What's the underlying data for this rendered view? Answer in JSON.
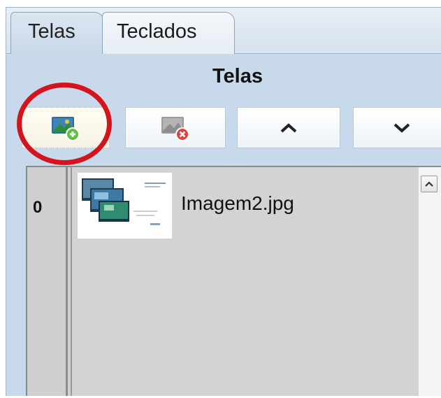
{
  "tabs": [
    {
      "label": "Telas",
      "active": true
    },
    {
      "label": "Teclados",
      "active": false
    }
  ],
  "panel": {
    "title": "Telas"
  },
  "toolbar": {
    "buttons": [
      {
        "name": "add-screen-button",
        "icon": "add-image-icon",
        "state": "focused"
      },
      {
        "name": "remove-screen-button",
        "icon": "remove-image-icon",
        "state": "disabled"
      },
      {
        "name": "move-up-button",
        "icon": "chevron-up-icon"
      },
      {
        "name": "move-down-button",
        "icon": "chevron-down-icon"
      }
    ]
  },
  "annotation": {
    "type": "highlight-circle",
    "color": "#d4141c",
    "target": "add-screen-button"
  },
  "list": {
    "items": [
      {
        "index": "0",
        "filename": "Imagem2.jpg",
        "thumbnail_icon": "image-thumbnail-icon"
      }
    ]
  },
  "colors": {
    "panel_bg": "#c8d9eb",
    "list_bg": "#d3d3d3",
    "highlight": "#d4141c"
  }
}
